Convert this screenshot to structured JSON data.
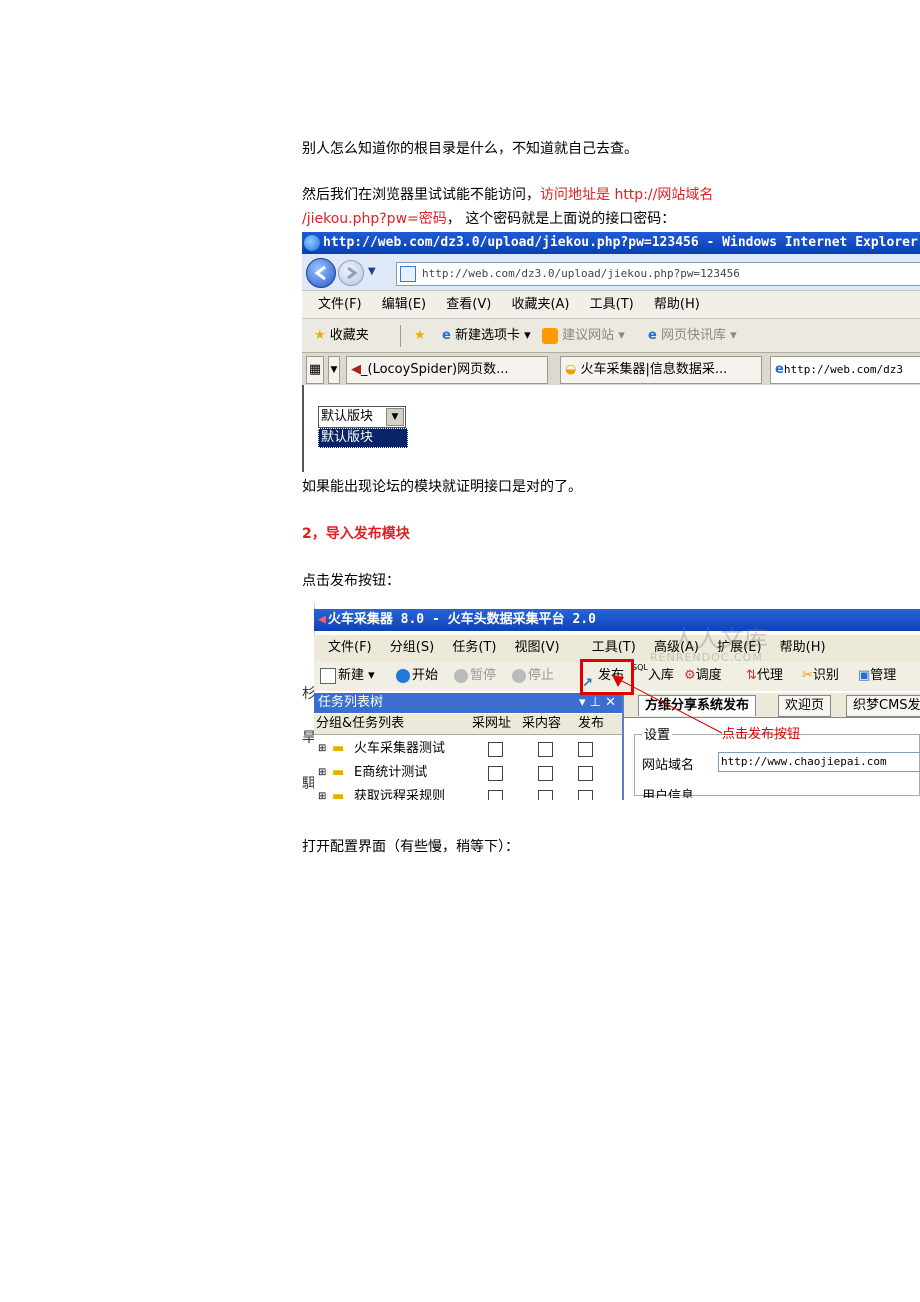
{
  "doc": {
    "line1": "别人怎么知道你的根目录是什么，不知道就自己去查。",
    "line2_black": "然后我们在浏览器里试试能不能访问，",
    "line2_red": "访问地址是 http://网站域名",
    "line3_red": "/jiekou.php?pw=密码",
    "line3_black": "，  这个密码就是上面说的接口密码：",
    "line4": "如果能出现论坛的模块就证明接口是对的了。",
    "heading": "2，导入发布模块",
    "line5": "点击发布按钮：",
    "line6": "打开配置界面（有些慢，稍等下）："
  },
  "ie": {
    "title": "http://web.com/dz3.0/upload/jiekou.php?pw=123456 - Windows Internet Explorer",
    "address": "http://web.com/dz3.0/upload/jiekou.php?pw=123456",
    "menu": [
      "文件(F)",
      "编辑(E)",
      "查看(V)",
      "收藏夹(A)",
      "工具(T)",
      "帮助(H)"
    ],
    "fav": {
      "favorites": "收藏夹",
      "new_tab": "新建选项卡 ▾",
      "suggested": "建议网站 ▾",
      "webslice": "网页快讯库 ▾"
    },
    "tabs": [
      "_(LocoySpider)网页数...",
      "火车采集器|信息数据采...",
      "http://web.com/dz3"
    ],
    "select_value": "默认版块",
    "option": "默认版块"
  },
  "locoy": {
    "title": "火车采集器 8.0 - 火车头数据采集平台 2.0",
    "menu": [
      "文件(F)",
      "分组(S)",
      "任务(T)",
      "视图(V)",
      "工具(T)",
      "高级(A)",
      "扩展(E)",
      "帮助(H)"
    ],
    "toolbar": {
      "new": "新建 ▾",
      "start": "开始",
      "pause": "暂停",
      "stop": "停止",
      "publish": "发布",
      "storage": "入库",
      "schedule": "调度",
      "proxy": "代理",
      "recognize": "识别",
      "manage": "管理",
      "sql": "SQL"
    },
    "tree_title": "任务列表树",
    "tree_controls": "▾ ⊥ ✕",
    "columns": [
      "分组&任务列表",
      "采网址",
      "采内容",
      "发布"
    ],
    "rows": [
      "火车采集器测试",
      "E商统计测试",
      "获取远程采规则"
    ],
    "right_tabs": [
      "方维分享系统发布",
      "欢迎页",
      "织梦CMS发"
    ],
    "settings_label": "设置",
    "domain_label": "网站域名",
    "domain_value": "http://www.chaojiepai.com",
    "user_info": "用户信息",
    "annotation": "点击发布按钮",
    "left_chars": [
      "杉",
      "旱",
      "駬"
    ]
  },
  "watermark": {
    "cn": "人人文库",
    "en": "RENRENDOC.COM"
  },
  "colors": {
    "red": "#e02020",
    "ie_title": "#0a3fb3",
    "highlight": "#e00000"
  }
}
